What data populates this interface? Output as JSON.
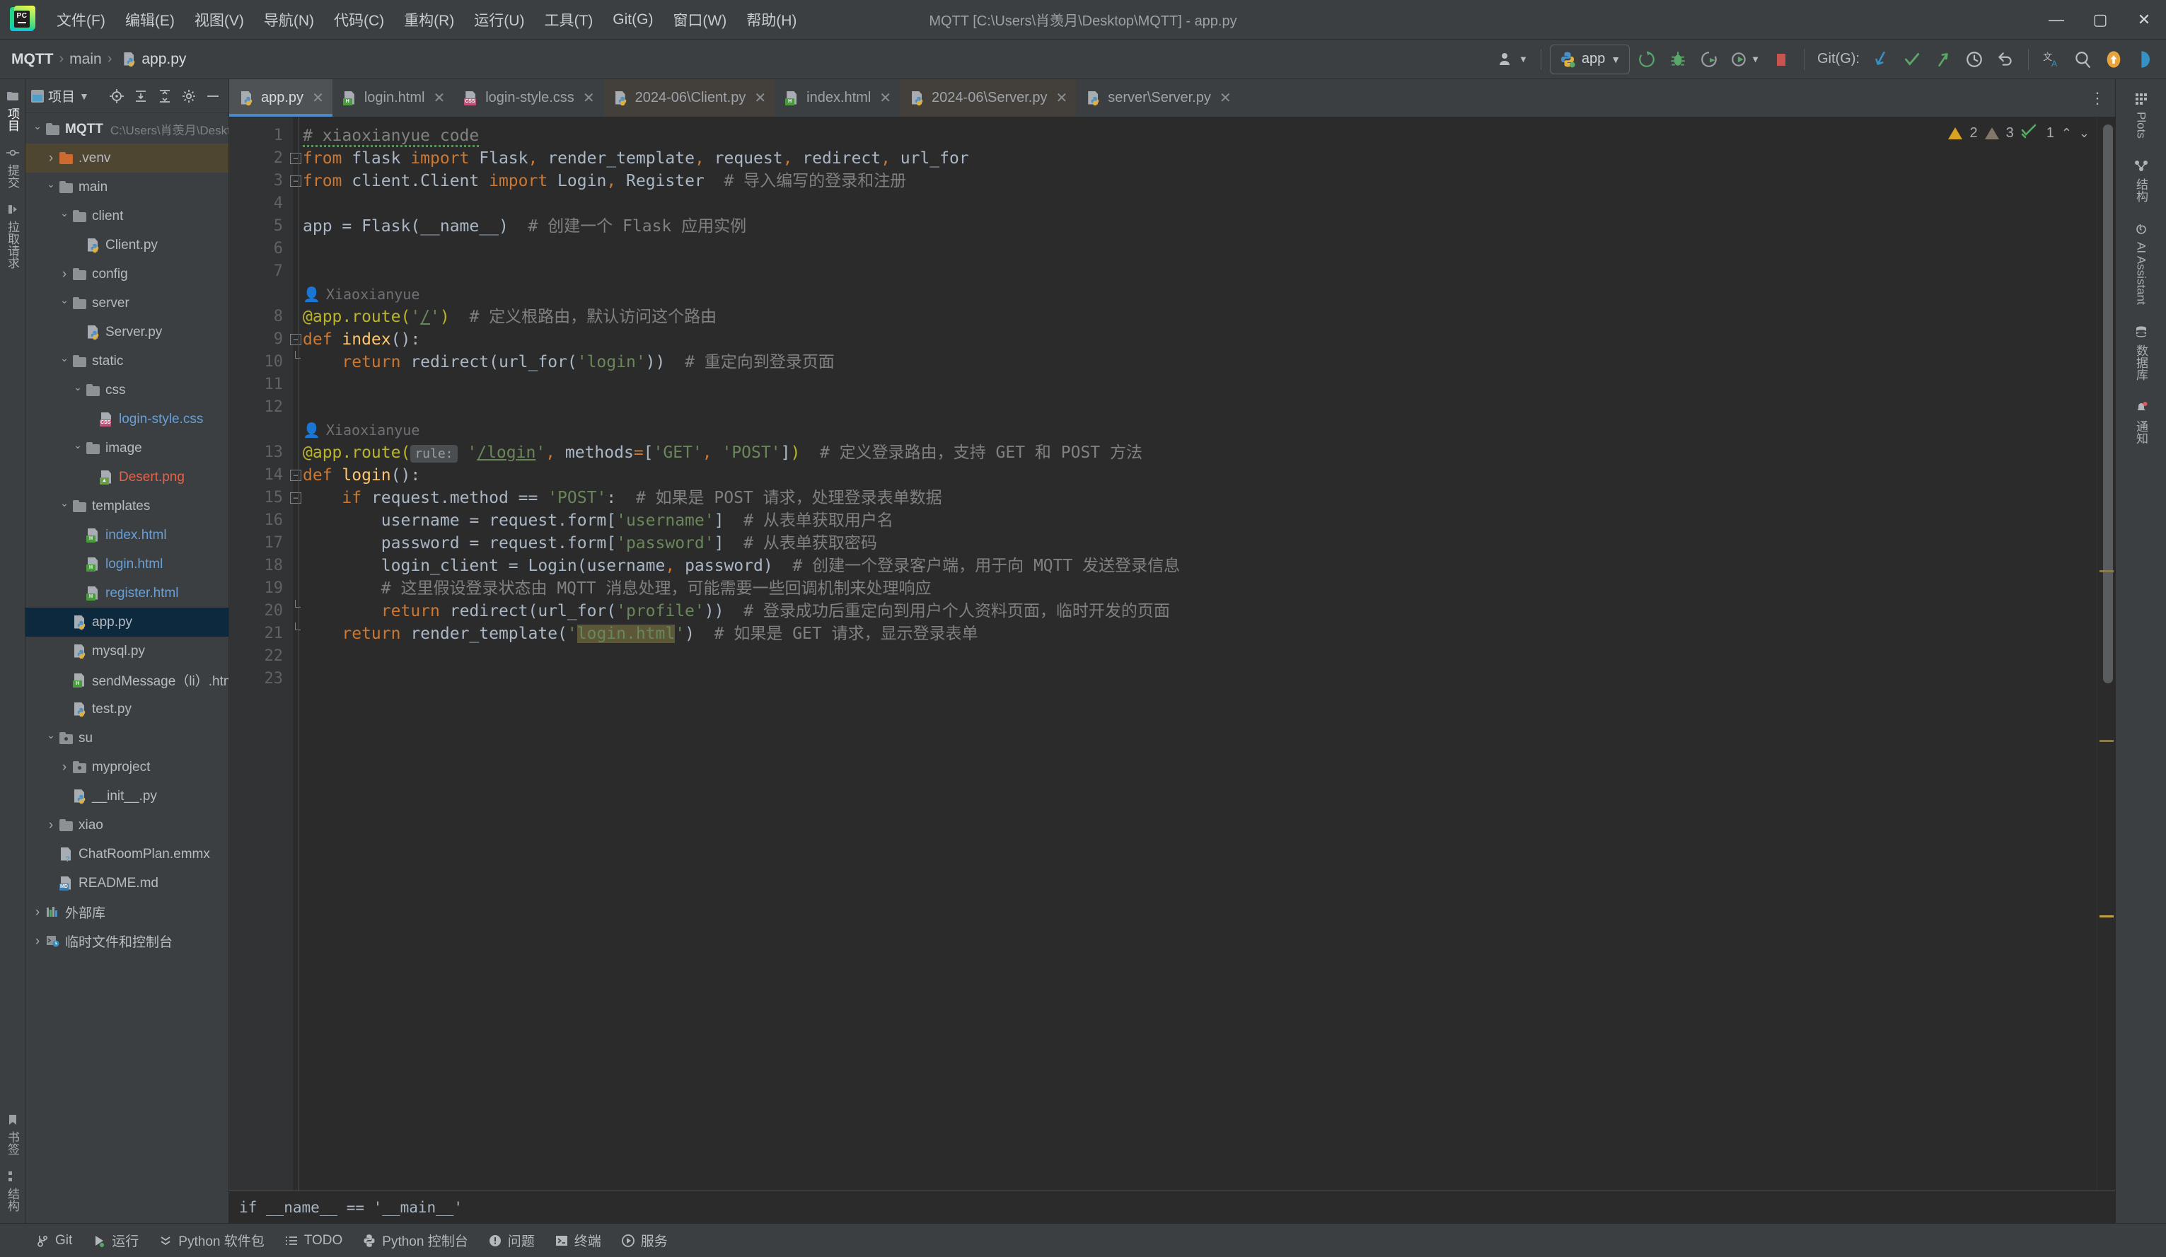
{
  "window": {
    "title": "MQTT [C:\\Users\\肖羡月\\Desktop\\MQTT] - app.py",
    "minimize": "—",
    "maximize": "▢",
    "close": "✕",
    "logo_text": "PC"
  },
  "menubar": {
    "items": [
      {
        "label": "文件(F)",
        "name": "menu-file"
      },
      {
        "label": "编辑(E)",
        "name": "menu-edit"
      },
      {
        "label": "视图(V)",
        "name": "menu-view"
      },
      {
        "label": "导航(N)",
        "name": "menu-navigate"
      },
      {
        "label": "代码(C)",
        "name": "menu-code"
      },
      {
        "label": "重构(R)",
        "name": "menu-refactor"
      },
      {
        "label": "运行(U)",
        "name": "menu-run"
      },
      {
        "label": "工具(T)",
        "name": "menu-tools"
      },
      {
        "label": "Git(G)",
        "name": "menu-git"
      },
      {
        "label": "窗口(W)",
        "name": "menu-window"
      },
      {
        "label": "帮助(H)",
        "name": "menu-help"
      }
    ]
  },
  "toolbar": {
    "breadcrumb": {
      "root": "MQTT",
      "mid": "main",
      "current": "app.py",
      "sep": "›"
    },
    "run_config": "app",
    "run_config_caret": "▼",
    "git_label": "Git(G):",
    "account_caret": "▼"
  },
  "left_rail": {
    "items": [
      {
        "label": "项目",
        "name": "rail-item-project"
      },
      {
        "label": "提交",
        "name": "rail-item-commit"
      },
      {
        "label": "拉取请求",
        "name": "rail-item-pull-requests"
      }
    ],
    "bottom": [
      {
        "label": "书签",
        "name": "rail-item-bookmarks"
      },
      {
        "label": "结构",
        "name": "rail-item-structure"
      }
    ]
  },
  "right_rail": {
    "items": [
      {
        "label": "Plots",
        "name": "rail-item-plots"
      },
      {
        "label": "结构",
        "name": "rail-item-structure-right"
      },
      {
        "label": "AI Assistant",
        "name": "rail-item-ai-assistant"
      },
      {
        "label": "数据库",
        "name": "rail-item-database"
      },
      {
        "label": "通知",
        "name": "rail-item-notifications"
      }
    ]
  },
  "project_panel": {
    "title": "项目",
    "title_caret": "▼",
    "tree": [
      {
        "depth": 0,
        "arrow": "open",
        "icon": "folder",
        "label": "MQTT",
        "path": "C:\\Users\\肖羡月\\Desktop\\MQTT",
        "style": "bold",
        "state": "none"
      },
      {
        "depth": 1,
        "arrow": "closed",
        "icon": "folder-orange",
        "label": ".venv",
        "path": "",
        "style": "norm",
        "state": "hl"
      },
      {
        "depth": 1,
        "arrow": "open",
        "icon": "folder",
        "label": "main",
        "path": "",
        "style": "norm",
        "state": "none"
      },
      {
        "depth": 2,
        "arrow": "open",
        "icon": "folder",
        "label": "client",
        "path": "",
        "style": "norm",
        "state": "none"
      },
      {
        "depth": 3,
        "arrow": "none",
        "icon": "py",
        "label": "Client.py",
        "path": "",
        "style": "py",
        "state": "none"
      },
      {
        "depth": 2,
        "arrow": "closed",
        "icon": "folder",
        "label": "config",
        "path": "",
        "style": "norm",
        "state": "none"
      },
      {
        "depth": 2,
        "arrow": "open",
        "icon": "folder",
        "label": "server",
        "path": "",
        "style": "norm",
        "state": "none"
      },
      {
        "depth": 3,
        "arrow": "none",
        "icon": "py",
        "label": "Server.py",
        "path": "",
        "style": "py",
        "state": "none"
      },
      {
        "depth": 2,
        "arrow": "open",
        "icon": "folder",
        "label": "static",
        "path": "",
        "style": "norm",
        "state": "none"
      },
      {
        "depth": 3,
        "arrow": "open",
        "icon": "folder",
        "label": "css",
        "path": "",
        "style": "norm",
        "state": "none"
      },
      {
        "depth": 4,
        "arrow": "none",
        "icon": "css",
        "label": "login-style.css",
        "path": "",
        "style": "css",
        "state": "none"
      },
      {
        "depth": 3,
        "arrow": "open",
        "icon": "folder",
        "label": "image",
        "path": "",
        "style": "norm",
        "state": "none"
      },
      {
        "depth": 4,
        "arrow": "none",
        "icon": "img",
        "label": "Desert.png",
        "path": "",
        "style": "red",
        "state": "none"
      },
      {
        "depth": 2,
        "arrow": "open",
        "icon": "folder",
        "label": "templates",
        "path": "",
        "style": "norm",
        "state": "none"
      },
      {
        "depth": 3,
        "arrow": "none",
        "icon": "html",
        "label": "index.html",
        "path": "",
        "style": "html",
        "state": "none"
      },
      {
        "depth": 3,
        "arrow": "none",
        "icon": "html",
        "label": "login.html",
        "path": "",
        "style": "html",
        "state": "none"
      },
      {
        "depth": 3,
        "arrow": "none",
        "icon": "html",
        "label": "register.html",
        "path": "",
        "style": "html",
        "state": "none"
      },
      {
        "depth": 2,
        "arrow": "none",
        "icon": "py",
        "label": "app.py",
        "path": "",
        "style": "norm",
        "state": "sel"
      },
      {
        "depth": 2,
        "arrow": "none",
        "icon": "py",
        "label": "mysql.py",
        "path": "",
        "style": "py",
        "state": "none"
      },
      {
        "depth": 2,
        "arrow": "none",
        "icon": "html",
        "label": "sendMessage（li）.html",
        "path": "",
        "style": "norm",
        "state": "none"
      },
      {
        "depth": 2,
        "arrow": "none",
        "icon": "py",
        "label": "test.py",
        "path": "",
        "style": "py",
        "state": "none"
      },
      {
        "depth": 1,
        "arrow": "open",
        "icon": "folder-mod",
        "label": "su",
        "path": "",
        "style": "norm",
        "state": "none"
      },
      {
        "depth": 2,
        "arrow": "closed",
        "icon": "folder-mod",
        "label": "myproject",
        "path": "",
        "style": "norm",
        "state": "none"
      },
      {
        "depth": 2,
        "arrow": "none",
        "icon": "py",
        "label": "__init__.py",
        "path": "",
        "style": "py",
        "state": "none"
      },
      {
        "depth": 1,
        "arrow": "closed",
        "icon": "folder",
        "label": "xiao",
        "path": "",
        "style": "norm",
        "state": "none"
      },
      {
        "depth": 1,
        "arrow": "none",
        "icon": "unknown",
        "label": "ChatRoomPlan.emmx",
        "path": "",
        "style": "norm",
        "state": "none"
      },
      {
        "depth": 1,
        "arrow": "none",
        "icon": "md",
        "label": "README.md",
        "path": "",
        "style": "norm",
        "state": "none"
      },
      {
        "depth": 0,
        "arrow": "closed",
        "icon": "lib",
        "label": "外部库",
        "path": "",
        "style": "norm",
        "state": "none"
      },
      {
        "depth": 0,
        "arrow": "closed",
        "icon": "scratch",
        "label": "临时文件和控制台",
        "path": "",
        "style": "norm",
        "state": "none"
      }
    ]
  },
  "tabs": [
    {
      "label": "app.py",
      "icon": "py",
      "active": true,
      "pinned": false,
      "close": "✕"
    },
    {
      "label": "login.html",
      "icon": "html",
      "active": false,
      "pinned": false,
      "close": "✕"
    },
    {
      "label": "login-style.css",
      "icon": "css",
      "active": false,
      "pinned": false,
      "close": "✕"
    },
    {
      "label": "2024-06\\Client.py",
      "icon": "py",
      "active": false,
      "pinned": true,
      "close": "✕"
    },
    {
      "label": "index.html",
      "icon": "html",
      "active": false,
      "pinned": false,
      "close": "✕"
    },
    {
      "label": "2024-06\\Server.py",
      "icon": "py",
      "active": false,
      "pinned": true,
      "close": "✕"
    },
    {
      "label": "server\\Server.py",
      "icon": "py",
      "active": false,
      "pinned": false,
      "close": "✕"
    }
  ],
  "inspections": {
    "warnings": "2",
    "weak_warnings": "3",
    "ok_count": "1",
    "up": "⌃",
    "down": "⌄"
  },
  "editor": {
    "bottom_preview": "if __name__ == '__main__'",
    "annotations": [
      "Xiaoxianyue",
      "Xiaoxianyue"
    ],
    "lines": [
      {
        "n": "1",
        "fold": "none"
      },
      {
        "n": "2",
        "fold": "head"
      },
      {
        "n": "3",
        "fold": "head"
      },
      {
        "n": "4",
        "fold": "none"
      },
      {
        "n": "5",
        "fold": "none"
      },
      {
        "n": "6",
        "fold": "none"
      },
      {
        "n": "7",
        "fold": "none"
      },
      {
        "n": "8",
        "fold": "none"
      },
      {
        "n": "9",
        "fold": "head"
      },
      {
        "n": "10",
        "fold": "tail"
      },
      {
        "n": "11",
        "fold": "none"
      },
      {
        "n": "12",
        "fold": "none"
      },
      {
        "n": "13",
        "fold": "none"
      },
      {
        "n": "14",
        "fold": "head"
      },
      {
        "n": "15",
        "fold": "head"
      },
      {
        "n": "16",
        "fold": "none"
      },
      {
        "n": "17",
        "fold": "none"
      },
      {
        "n": "18",
        "fold": "none"
      },
      {
        "n": "19",
        "fold": "none"
      },
      {
        "n": "20",
        "fold": "tail"
      },
      {
        "n": "21",
        "fold": "tail"
      },
      {
        "n": "22",
        "fold": "none"
      },
      {
        "n": "23",
        "fold": "none"
      }
    ],
    "code_text": {
      "l1": "# xiaoxianyue code",
      "l2": "from flask import Flask, render_template, request, redirect, url_for",
      "l3": "from client.Client import Login, Register  # 导入编写的登录和注册",
      "l5": "app = Flask(__name__)  # 创建一个 Flask 应用实例",
      "l8": "@app.route('/')  # 定义根路由，默认访问这个路由",
      "l9": "def index():",
      "l10": "    return redirect(url_for('login'))  # 重定向到登录页面",
      "l13": "@app.route( rule: '/login', methods=['GET', 'POST'])  # 定义登录路由，支持 GET 和 POST 方法",
      "l14": "def login():",
      "l15": "    if request.method == 'POST':  # 如果是 POST 请求，处理登录表单数据",
      "l16": "        username = request.form['username']  # 从表单获取用户名",
      "l17": "        password = request.form['password']  # 从表单获取密码",
      "l18": "        login_client = Login(username, password)  # 创建一个登录客户端，用于向 MQTT 发送登录信息",
      "l19": "        # 这里假设登录状态由 MQTT 消息处理，可能需要一些回调机制来处理响应",
      "l20": "        return redirect(url_for('profile'))  # 登录成功后重定向到用户个人资料页面，临时开发的页面",
      "l21": "    return render_template('login.html')  # 如果是 GET 请求，显示登录表单"
    }
  },
  "statusbar": {
    "items": [
      {
        "label": "Git",
        "name": "status-git",
        "icon": "git-icon"
      },
      {
        "label": "运行",
        "name": "status-run",
        "icon": "run-icon"
      },
      {
        "label": "Python 软件包",
        "name": "status-python-packages",
        "icon": "packages-icon"
      },
      {
        "label": "TODO",
        "name": "status-todo",
        "icon": "todo-icon"
      },
      {
        "label": "Python 控制台",
        "name": "status-python-console",
        "icon": "python-icon"
      },
      {
        "label": "问题",
        "name": "status-problems",
        "icon": "problems-icon"
      },
      {
        "label": "终端",
        "name": "status-terminal",
        "icon": "terminal-icon"
      },
      {
        "label": "服务",
        "name": "status-services",
        "icon": "services-icon"
      }
    ]
  },
  "colors": {
    "accent": "#4a88c7",
    "warning": "#d9a322",
    "selection": "#0d293e",
    "highlight": "#4e4631",
    "keyword": "#cc7832",
    "string": "#6a8759",
    "comment": "#808080",
    "decorator": "#bbb529",
    "function": "#ffc66d",
    "identifier": "#a9b7c6"
  }
}
